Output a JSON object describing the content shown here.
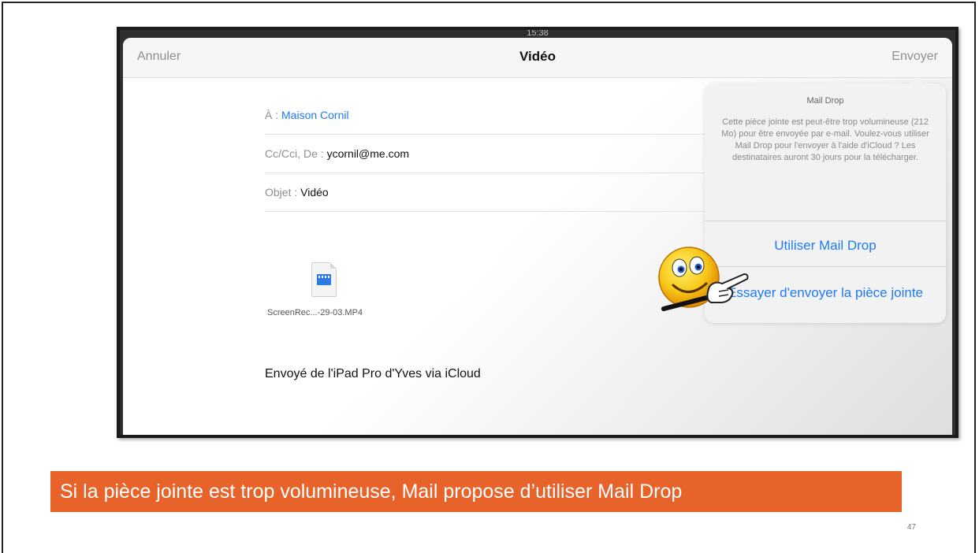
{
  "screen": {
    "status_time": "15:38",
    "navbar": {
      "cancel_label": "Annuler",
      "title": "Vidéo",
      "send_label": "Envoyer"
    },
    "fields": {
      "to_label": "À :",
      "to_value": "Maison Cornil",
      "cc_label": "Cc/Cci, De :",
      "cc_value": "ycornil@me.com",
      "subject_label": "Objet :",
      "subject_value": "Vidéo"
    },
    "attachment": {
      "file_name": "ScreenRec...-29-03.MP4",
      "icon": "video-file-icon"
    },
    "signature": "Envoyé de l'iPad Pro d'Yves via iCloud",
    "popover": {
      "title": "Mail Drop",
      "message": "Cette pièce jointe est peut-être trop volumineuse (212 Mo) pour être envoyée par e-mail. Voulez-vous utiliser Mail Drop pour l'envoyer à l'aide d'iCloud ? Les destinataires auront 30 jours pour la télécharger.",
      "primary_action": "Utiliser Mail Drop",
      "secondary_action": "Essayer d'envoyer la pièce jointe"
    }
  },
  "caption": "Si la pièce jointe est trop volumineuse, Mail propose d’utiliser Mail Drop",
  "page_number": "47",
  "colors": {
    "caption_background": "#e8632a",
    "link_blue": "#1f7cf4"
  }
}
